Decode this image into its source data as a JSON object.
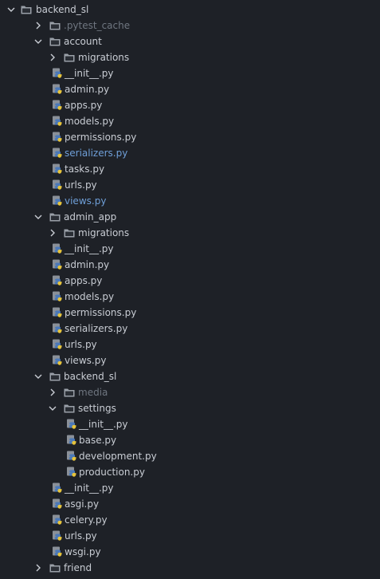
{
  "colors": {
    "background": "#1e2127",
    "text": "#c9cdd4",
    "dim_text": "#6f7680",
    "modified_text": "#6f9fd8",
    "folder_icon": "#9aa0a8",
    "python_blue": "#4a78b8",
    "python_yellow": "#e6c43c"
  },
  "tree": [
    {
      "label": "backend_sl",
      "kind": "folder",
      "depth": 0,
      "expanded": true
    },
    {
      "label": ".pytest_cache",
      "kind": "folder",
      "depth": 1,
      "expanded": false,
      "style": "dim"
    },
    {
      "label": "account",
      "kind": "folder",
      "depth": 1,
      "expanded": true
    },
    {
      "label": "migrations",
      "kind": "folder",
      "depth": 2,
      "expanded": false
    },
    {
      "label": "__init__.py",
      "kind": "python",
      "depth": 2
    },
    {
      "label": "admin.py",
      "kind": "python",
      "depth": 2
    },
    {
      "label": "apps.py",
      "kind": "python",
      "depth": 2
    },
    {
      "label": "models.py",
      "kind": "python",
      "depth": 2
    },
    {
      "label": "permissions.py",
      "kind": "python",
      "depth": 2
    },
    {
      "label": "serializers.py",
      "kind": "python",
      "depth": 2,
      "style": "modified"
    },
    {
      "label": "tasks.py",
      "kind": "python",
      "depth": 2
    },
    {
      "label": "urls.py",
      "kind": "python",
      "depth": 2
    },
    {
      "label": "views.py",
      "kind": "python",
      "depth": 2,
      "style": "modified"
    },
    {
      "label": "admin_app",
      "kind": "folder",
      "depth": 1,
      "expanded": true
    },
    {
      "label": "migrations",
      "kind": "folder",
      "depth": 2,
      "expanded": false
    },
    {
      "label": "__init__.py",
      "kind": "python",
      "depth": 2
    },
    {
      "label": "admin.py",
      "kind": "python",
      "depth": 2
    },
    {
      "label": "apps.py",
      "kind": "python",
      "depth": 2
    },
    {
      "label": "models.py",
      "kind": "python",
      "depth": 2
    },
    {
      "label": "permissions.py",
      "kind": "python",
      "depth": 2
    },
    {
      "label": "serializers.py",
      "kind": "python",
      "depth": 2
    },
    {
      "label": "urls.py",
      "kind": "python",
      "depth": 2
    },
    {
      "label": "views.py",
      "kind": "python",
      "depth": 2
    },
    {
      "label": "backend_sl",
      "kind": "folder",
      "depth": 1,
      "expanded": true
    },
    {
      "label": "media",
      "kind": "folder",
      "depth": 2,
      "expanded": false,
      "style": "dim"
    },
    {
      "label": "settings",
      "kind": "folder",
      "depth": 2,
      "expanded": true
    },
    {
      "label": "__init__.py",
      "kind": "python",
      "depth": 3
    },
    {
      "label": "base.py",
      "kind": "python",
      "depth": 3
    },
    {
      "label": "development.py",
      "kind": "python",
      "depth": 3
    },
    {
      "label": "production.py",
      "kind": "python",
      "depth": 3
    },
    {
      "label": "__init__.py",
      "kind": "python",
      "depth": 2
    },
    {
      "label": "asgi.py",
      "kind": "python",
      "depth": 2
    },
    {
      "label": "celery.py",
      "kind": "python",
      "depth": 2
    },
    {
      "label": "urls.py",
      "kind": "python",
      "depth": 2
    },
    {
      "label": "wsgi.py",
      "kind": "python",
      "depth": 2
    },
    {
      "label": "friend",
      "kind": "folder",
      "depth": 1,
      "expanded": false
    }
  ]
}
